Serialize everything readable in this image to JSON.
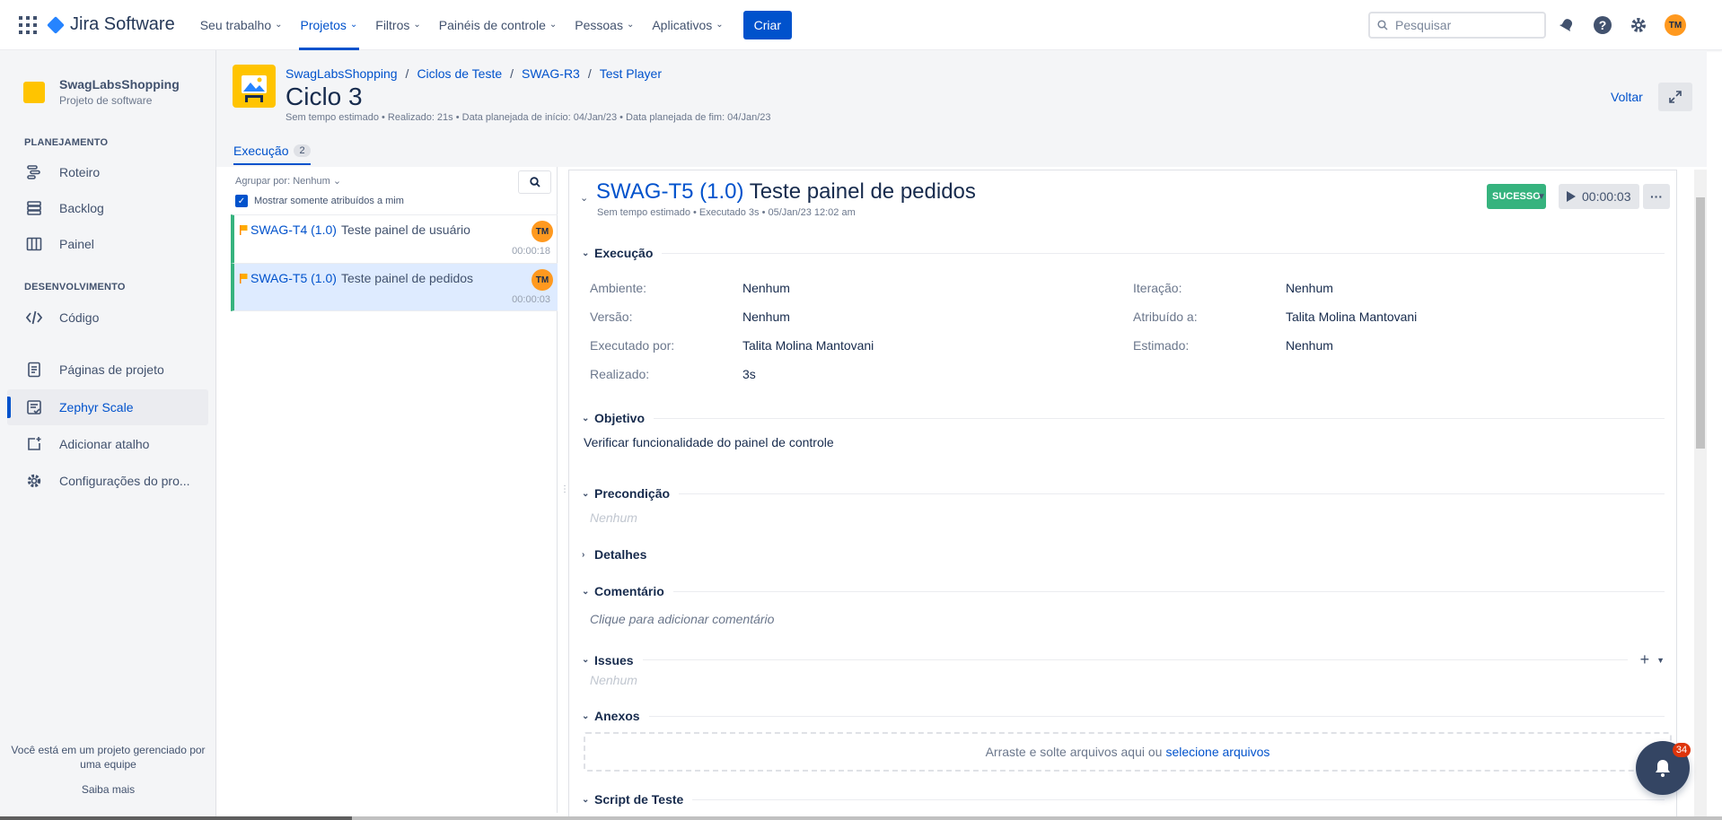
{
  "topnav": {
    "product": "Jira Software",
    "items": [
      {
        "label": "Seu trabalho"
      },
      {
        "label": "Projetos"
      },
      {
        "label": "Filtros"
      },
      {
        "label": "Painéis de controle"
      },
      {
        "label": "Pessoas"
      },
      {
        "label": "Aplicativos"
      }
    ],
    "create_label": "Criar",
    "search_placeholder": "Pesquisar",
    "user_initials": "TM"
  },
  "sidebar": {
    "project_name": "SwagLabsShopping",
    "project_type": "Projeto de software",
    "planning_heading": "PLANEJAMENTO",
    "planning_items": [
      {
        "label": "Roteiro",
        "icon": "roadmap-icon"
      },
      {
        "label": "Backlog",
        "icon": "backlog-icon"
      },
      {
        "label": "Painel",
        "icon": "board-icon"
      }
    ],
    "dev_heading": "DESENVOLVIMENTO",
    "dev_items": [
      {
        "label": "Código",
        "icon": "code-icon"
      }
    ],
    "other_items": [
      {
        "label": "Páginas de projeto",
        "icon": "page-icon"
      },
      {
        "label": "Zephyr Scale",
        "icon": "zephyr-icon"
      },
      {
        "label": "Adicionar atalho",
        "icon": "add-shortcut-icon"
      },
      {
        "label": "Configurações do pro...",
        "icon": "gear-icon"
      }
    ],
    "footer_text": "Você está em um projeto gerenciado por uma equipe",
    "footer_link": "Saiba mais"
  },
  "header": {
    "breadcrumbs": [
      "SwagLabsShopping",
      "Ciclos de Teste",
      "SWAG-R3",
      "Test Player"
    ],
    "title": "Ciclo 3",
    "meta": "Sem tempo estimado  •  Realizado: 21s  •  Data planejada de início: 04/Jan/23  •  Data planejada de fim: 04/Jan/23",
    "back_label": "Voltar"
  },
  "tabs": {
    "execution_label": "Execução",
    "execution_count": "2"
  },
  "list": {
    "group_by": "Agrupar por: Nenhum",
    "only_assigned": "Mostrar somente atribuídos a mim",
    "items": [
      {
        "key": "SWAG-T4 (1.0)",
        "name": "Teste painel de usuário",
        "time": "00:00:18",
        "assignee": "TM"
      },
      {
        "key": "SWAG-T5 (1.0)",
        "name": "Teste painel de pedidos",
        "time": "00:00:03",
        "assignee": "TM"
      }
    ]
  },
  "detail": {
    "key": "SWAG-T5 (1.0)",
    "name": "Teste painel de pedidos",
    "meta": "Sem tempo estimado  •  Executado 3s  •  05/Jan/23 12:02 am",
    "status": "SUCESSO",
    "timer": "00:00:03",
    "sections": {
      "execution": "Execução",
      "objective": "Objetivo",
      "precondition": "Precondição",
      "details": "Detalhes",
      "comment": "Comentário",
      "issues": "Issues",
      "attachments": "Anexos",
      "script": "Script de Teste"
    },
    "fields": {
      "ambiente_label": "Ambiente:",
      "ambiente_value": "Nenhum",
      "versao_label": "Versão:",
      "versao_value": "Nenhum",
      "executado_label": "Executado por:",
      "executado_value": "Talita Molina Mantovani",
      "realizado_label": "Realizado:",
      "realizado_value": "3s",
      "iteracao_label": "Iteração:",
      "iteracao_value": "Nenhum",
      "atribuido_label": "Atribuído a:",
      "atribuido_value": "Talita Molina Mantovani",
      "estimado_label": "Estimado:",
      "estimado_value": "Nenhum"
    },
    "objective_text": "Verificar funcionalidade do painel de controle",
    "precondition_text": "Nenhum",
    "comment_placeholder": "Clique para adicionar comentário",
    "issues_text": "Nenhum",
    "drop_text": "Arraste e solte arquivos aqui ou",
    "drop_link": "selecione arquivos"
  },
  "notifications": {
    "count": "34"
  },
  "colors": {
    "accent": "#0052cc",
    "success": "#36b37e",
    "avatar": "#ff991f"
  }
}
